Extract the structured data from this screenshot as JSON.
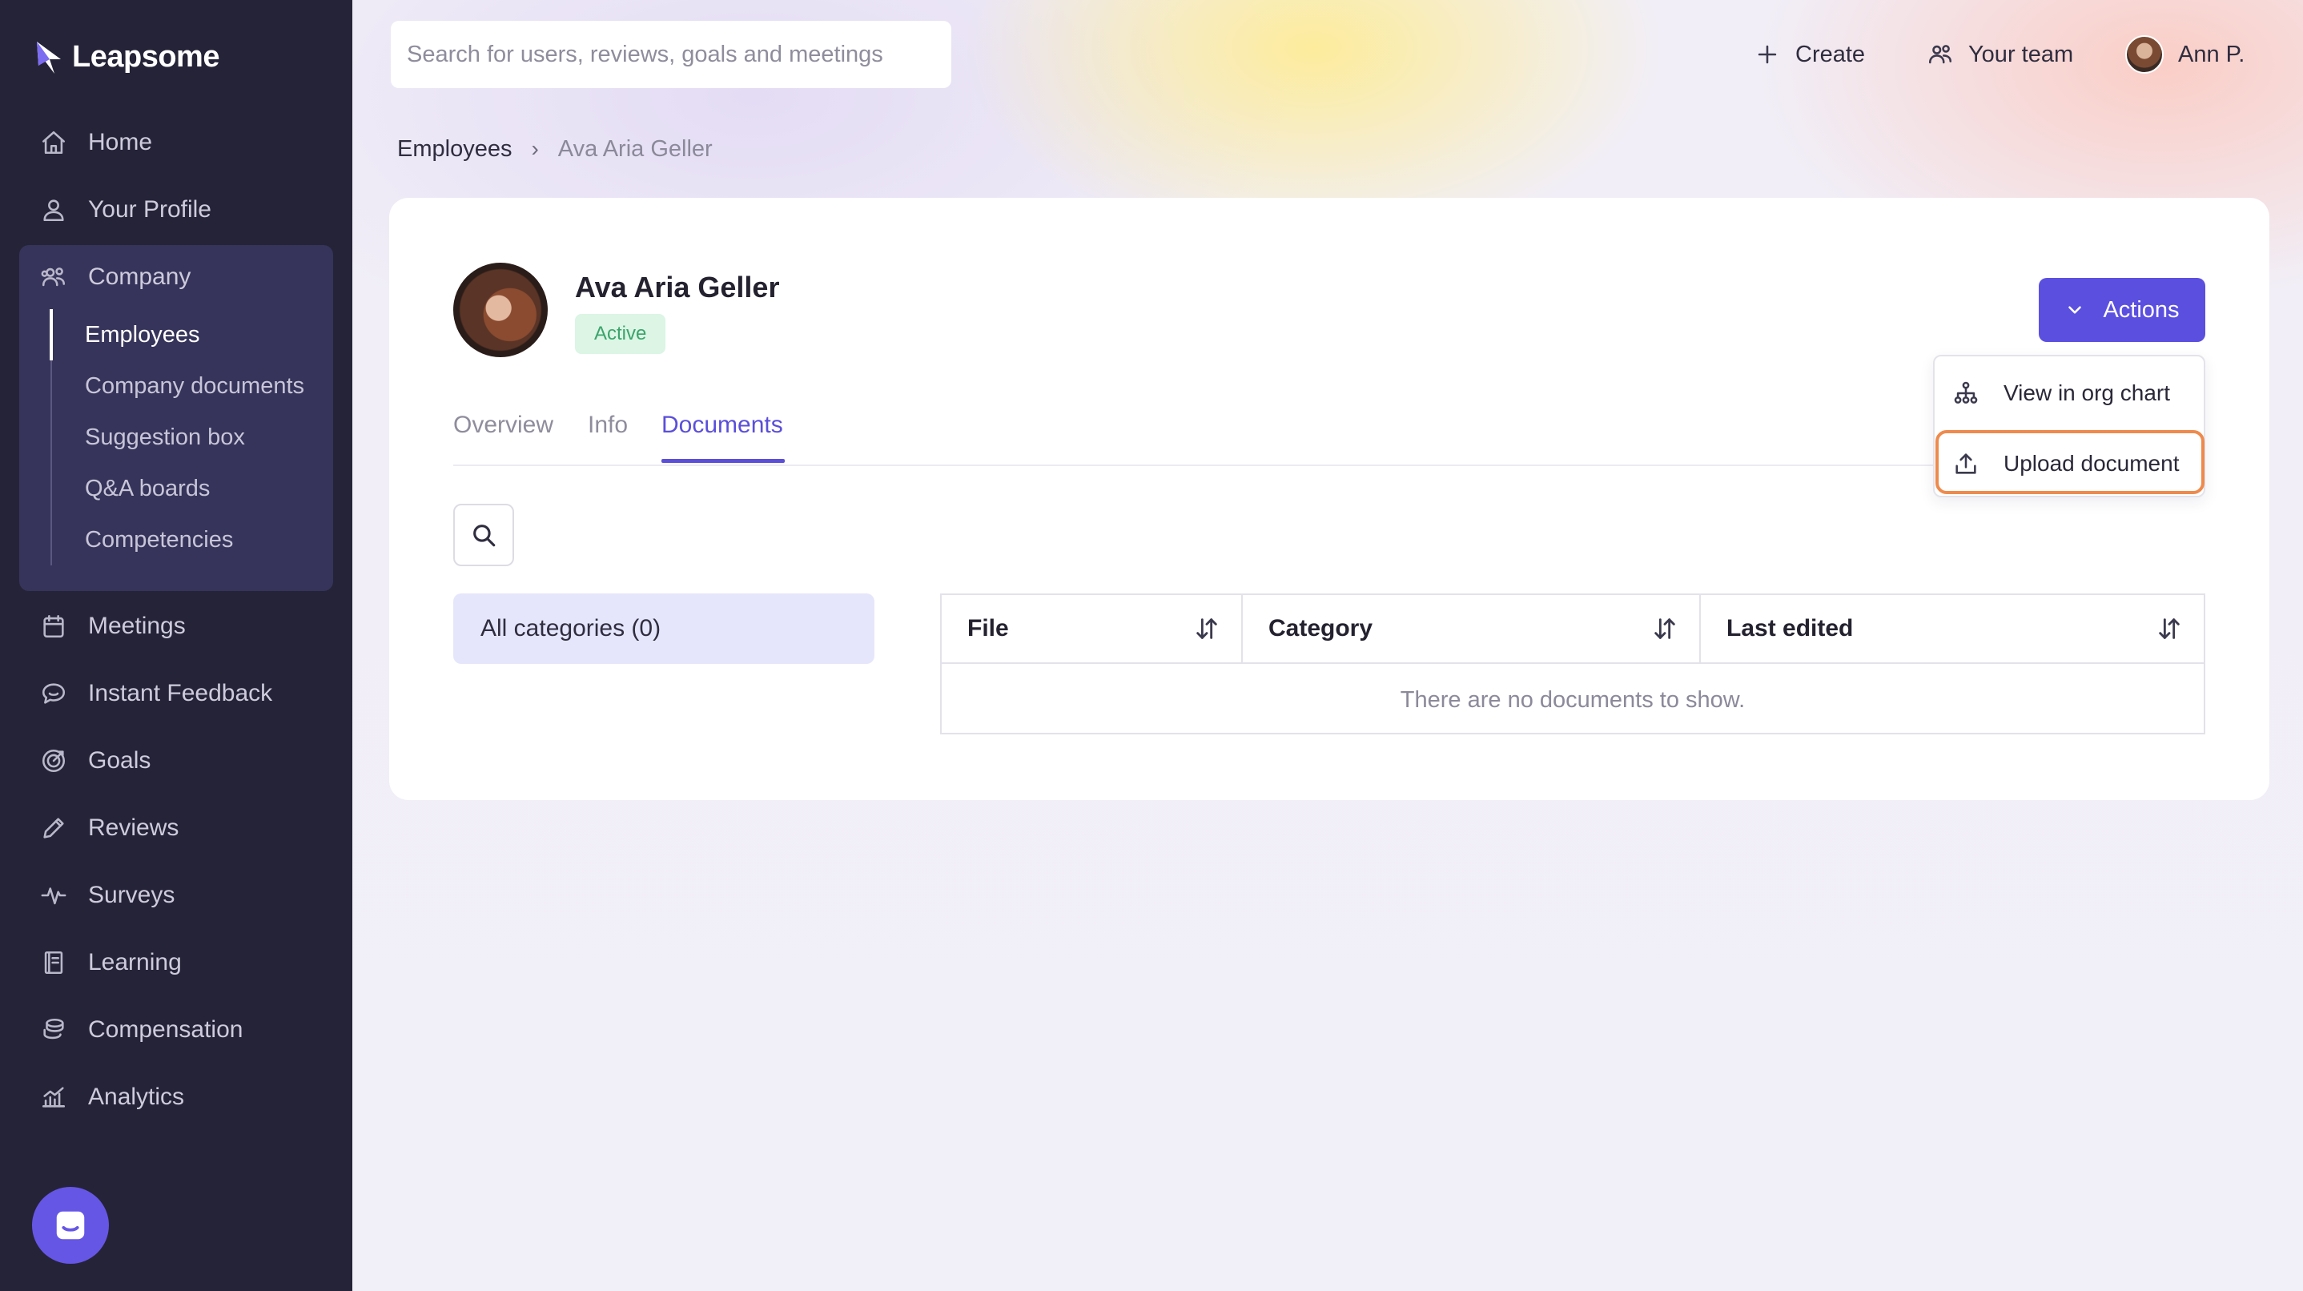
{
  "app": {
    "name": "Leapsome"
  },
  "sidebar": {
    "items": [
      {
        "label": "Home",
        "icon": "home-icon"
      },
      {
        "label": "Your Profile",
        "icon": "user-icon"
      },
      {
        "label": "Company",
        "icon": "people-icon"
      },
      {
        "label": "Meetings",
        "icon": "calendar-icon"
      },
      {
        "label": "Instant Feedback",
        "icon": "chat-icon"
      },
      {
        "label": "Goals",
        "icon": "target-icon"
      },
      {
        "label": "Reviews",
        "icon": "pencil-icon"
      },
      {
        "label": "Surveys",
        "icon": "pulse-icon"
      },
      {
        "label": "Learning",
        "icon": "book-icon"
      },
      {
        "label": "Compensation",
        "icon": "coins-icon"
      },
      {
        "label": "Analytics",
        "icon": "chart-icon"
      }
    ],
    "company_sub": [
      "Employees",
      "Company documents",
      "Suggestion box",
      "Q&A boards",
      "Competencies"
    ],
    "active_sub": "Employees"
  },
  "topbar": {
    "search_placeholder": "Search for users, reviews, goals and meetings",
    "create_label": "Create",
    "team_label": "Your team",
    "user_label": "Ann P."
  },
  "breadcrumb": {
    "parent": "Employees",
    "separator": "›",
    "current": "Ava Aria Geller"
  },
  "profile": {
    "name": "Ava Aria Geller",
    "status": "Active"
  },
  "tabs": [
    {
      "label": "Overview",
      "active": false
    },
    {
      "label": "Info",
      "active": false
    },
    {
      "label": "Documents",
      "active": true
    }
  ],
  "filters": {
    "category_label": "All categories (0)"
  },
  "table": {
    "columns": [
      "File",
      "Category",
      "Last edited"
    ],
    "empty_message": "There are no documents to show."
  },
  "actions": {
    "button_label": "Actions",
    "menu": [
      {
        "label": "View in org chart",
        "icon": "org-chart-icon"
      },
      {
        "label": "Upload document",
        "icon": "upload-icon",
        "highlighted": true
      }
    ]
  },
  "colors": {
    "sidebar_bg": "#252337",
    "accent": "#5b4fe0",
    "status_bg": "#dcf5e5",
    "status_text": "#3aa46a",
    "highlight": "#ee8a4d"
  }
}
